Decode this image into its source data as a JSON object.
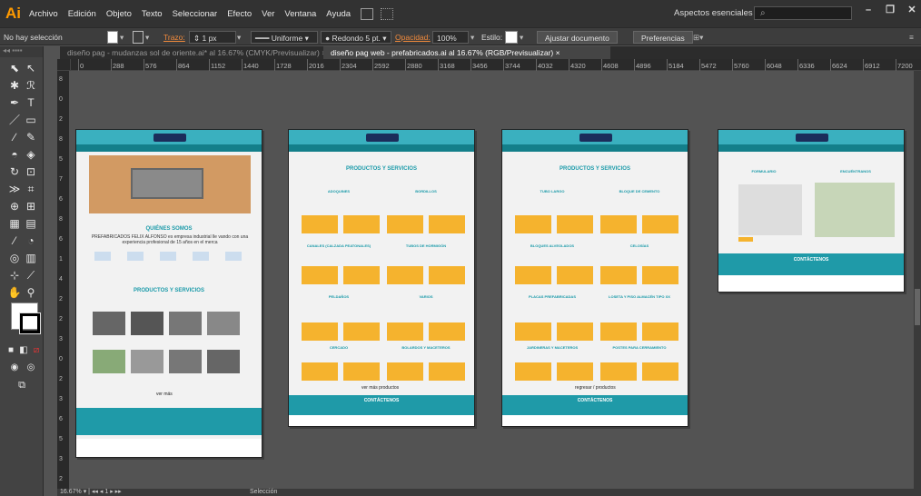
{
  "menubar": {
    "logo": "Ai",
    "items": [
      "Archivo",
      "Edición",
      "Objeto",
      "Texto",
      "Seleccionar",
      "Efecto",
      "Ver",
      "Ventana",
      "Ayuda"
    ],
    "workspace": "Aspectos esenciales",
    "search_placeholder": "",
    "minimize": "–",
    "maximize": "❐",
    "close": "✕"
  },
  "control": {
    "selection": "No hay selección",
    "stroke_label": "Trazo:",
    "stroke_value": "1 px",
    "profile": "Uniforme",
    "brush": "Redondo 5 pt.",
    "opacity_label": "Opacidad:",
    "opacity_value": "100%",
    "style_label": "Estilo:",
    "fit_button": "Ajustar documento",
    "prefs_button": "Preferencias"
  },
  "tabs": [
    {
      "label": "diseño pag - mudanzas sol de oriente.ai* al 16.67% (CMYK/Previsualizar)",
      "close": "×"
    },
    {
      "label": "diseño pag web - prefabricados.ai al 16.67% (RGB/Previsualizar)",
      "close": "×"
    }
  ],
  "hruler": [
    "0",
    "288",
    "576",
    "864",
    "1152",
    "1440",
    "1728",
    "2016",
    "2304",
    "2592",
    "2880",
    "3168",
    "3456",
    "3744",
    "4032",
    "4320",
    "4608",
    "4896",
    "5184",
    "5472",
    "5760",
    "6048",
    "6336",
    "6624",
    "6912",
    "7200"
  ],
  "vruler": [
    "8",
    "0",
    "2",
    "8",
    "5",
    "7",
    "6",
    "8",
    "6",
    "1",
    "4",
    "2",
    "2",
    "3",
    "0",
    "2",
    "3",
    "6",
    "5",
    "3",
    "2"
  ],
  "artboards": {
    "ab1": {
      "title": "QUIÉNES SOMOS",
      "intro": "PREFABRICADOS FELIX ALFONSO es empresa industrial lle vando con una experiencia profesional de 15 años en el merca",
      "products": "PRODUCTOS Y SERVICIOS",
      "more": "ver más"
    },
    "ab2": {
      "title": "PRODUCTOS Y SERVICIOS",
      "items": [
        "ADOQUINES",
        "BORDILLOS",
        "CANALES (CALZADA PEATONALES)",
        "TUBOS DE HORMIGÓN",
        "PELDAÑOS",
        "VARIOS",
        "CERCADO",
        "BOLARDOS Y MACETEROS"
      ],
      "more": "ver más productos",
      "footer": "CONTÁCTENOS"
    },
    "ab3": {
      "title": "PRODUCTOS Y SERVICIOS",
      "items": [
        "TUBO LARGO",
        "BLOQUE DE CEMENTO",
        "BLOQUES ALVEOLADOS",
        "CELOSÍAS",
        "PLACAS PREFABRICADAS",
        "LOSETA Y PISO ALMACÉN TIPO XX",
        "JARDINERAS Y MACETEROS",
        "POSTES PARA CERRAMIENTO"
      ],
      "more": "regresar / productos",
      "footer": "CONTÁCTENOS"
    },
    "ab4": {
      "col1": "FORMULARIO",
      "col2": "ENCUÉNTRANOS",
      "footer": "CONTÁCTENOS"
    }
  },
  "status": {
    "zoom": "16.67%",
    "page": "1",
    "mode": "Selección"
  },
  "colors": {
    "accent": "#3ab0bf",
    "accent_dark": "#137f8a",
    "yellow": "#f5b32e",
    "logo": "#ff9a00"
  }
}
